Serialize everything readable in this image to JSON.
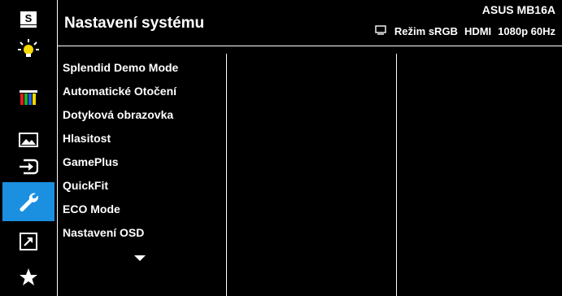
{
  "header": {
    "title": "Nastavení systému",
    "model": "ASUS MB16A",
    "status": {
      "mode": "Režim sRGB",
      "input": "HDMI",
      "resolution": "1080p 60Hz"
    }
  },
  "sidebar": {
    "items": [
      {
        "icon": "splendid-s-icon"
      },
      {
        "icon": "blue-light-bulb-icon"
      },
      {
        "icon": "color-bars-icon"
      },
      {
        "icon": "image-icon"
      },
      {
        "icon": "input-select-icon"
      },
      {
        "icon": "wrench-icon",
        "active": true
      },
      {
        "icon": "shortcut-arrow-icon"
      },
      {
        "icon": "star-icon"
      }
    ]
  },
  "menu": {
    "items": [
      "Splendid Demo Mode",
      "Automatické Otočení",
      "Dotyková obrazovka",
      "Hlasitost",
      "GamePlus",
      "QuickFit",
      "ECO Mode",
      "Nastavení OSD"
    ]
  },
  "colors": {
    "background": "#000000",
    "accent": "#1b8fe0",
    "text": "#ffffff"
  }
}
